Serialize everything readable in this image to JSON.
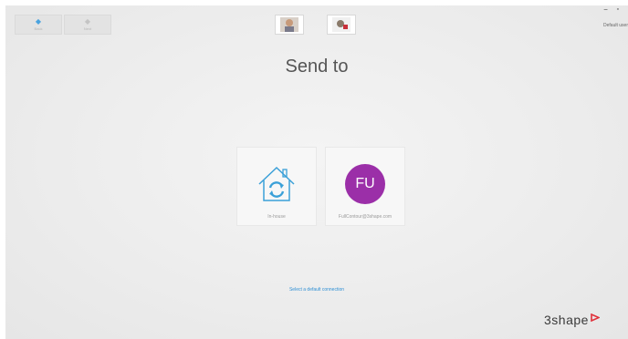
{
  "nav": {
    "back_label": "Back",
    "forward_label": "Next"
  },
  "window": {
    "controls": "– ▫"
  },
  "header": {
    "default_user": "Default user"
  },
  "main": {
    "title": "Send to",
    "tiles": [
      {
        "label": "In-house",
        "icon": "house-sync-icon"
      },
      {
        "label": "FU",
        "caption": "FullContour@3shape.com",
        "color": "#9b2fa8"
      }
    ],
    "default_connection_link": "Select a default connection"
  },
  "brand": {
    "logo_text": "3shape",
    "accent": "#e0303a"
  }
}
